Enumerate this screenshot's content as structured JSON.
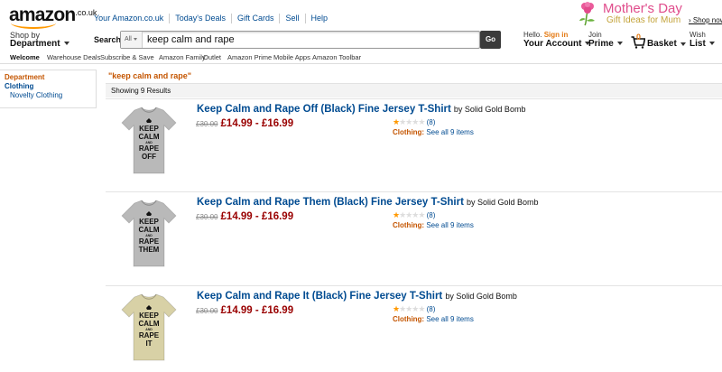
{
  "header": {
    "logo": "amazon",
    "logo_tld": ".co.uk",
    "links": [
      "Your Amazon.co.uk",
      "Today's Deals",
      "Gift Cards",
      "Sell",
      "Help"
    ],
    "promo": {
      "title": "Mother's Day",
      "subtitle": "Gift Ideas for Mum",
      "cta": "› Shop now"
    }
  },
  "nav": {
    "shop_by_line1": "Shop by",
    "shop_by_line2": "Department",
    "search_label": "Search",
    "search_category": "All",
    "search_value": "keep calm and rape",
    "go_label": "Go",
    "account_hello": "Hello.",
    "account_signin": "Sign in",
    "account_label": "Your Account",
    "prime_line1": "Join",
    "prime_line2": "Prime",
    "basket_count": "0",
    "basket_label": "Basket",
    "wish_line1": "Wish",
    "wish_line2": "List"
  },
  "subnav": {
    "items": [
      "Welcome",
      "Warehouse Deals",
      "Subscribe & Save",
      "Amazon Family",
      "Outlet",
      "Amazon Prime",
      "Mobile Apps",
      "Amazon Toolbar"
    ]
  },
  "sidebar": {
    "heading": "Department",
    "category": "Clothing",
    "subcategory": "Novelty Clothing"
  },
  "results": {
    "query": "\"keep calm and rape\"",
    "showing": "Showing 9 Results",
    "items": [
      {
        "title": "Keep Calm and Rape Off (Black) Fine Jersey T-Shirt",
        "by": "by Solid Gold Bomb",
        "old_price": "£30.00",
        "price": "£14.99 - £16.99",
        "rating": 1,
        "reviews": "(8)",
        "cat_key": "Clothing:",
        "cat_link": "See all 9 items",
        "shirt_color": "#b9b9b9",
        "shirt_text": [
          "KEEP",
          "CALM",
          "AND",
          "RAPE",
          "OFF"
        ]
      },
      {
        "title": "Keep Calm and Rape Them (Black) Fine Jersey T-Shirt",
        "by": "by Solid Gold Bomb",
        "old_price": "£30.00",
        "price": "£14.99 - £16.99",
        "rating": 1,
        "reviews": "(8)",
        "cat_key": "Clothing:",
        "cat_link": "See all 9 items",
        "shirt_color": "#b9b9b9",
        "shirt_text": [
          "KEEP",
          "CALM",
          "AND",
          "RAPE",
          "THEM"
        ]
      },
      {
        "title": "Keep Calm and Rape It (Black) Fine Jersey T-Shirt",
        "by": "by Solid Gold Bomb",
        "old_price": "£30.00",
        "price": "£14.99 - £16.99",
        "rating": 1,
        "reviews": "(8)",
        "cat_key": "Clothing:",
        "cat_link": "See all 9 items",
        "shirt_color": "#d8d1a6",
        "shirt_text": [
          "KEEP",
          "CALM",
          "AND",
          "RAPE",
          "IT"
        ]
      }
    ]
  },
  "colors": {
    "link": "#004b91",
    "price": "#990000",
    "accent_orange": "#e47911",
    "department_orange": "#c45500"
  }
}
